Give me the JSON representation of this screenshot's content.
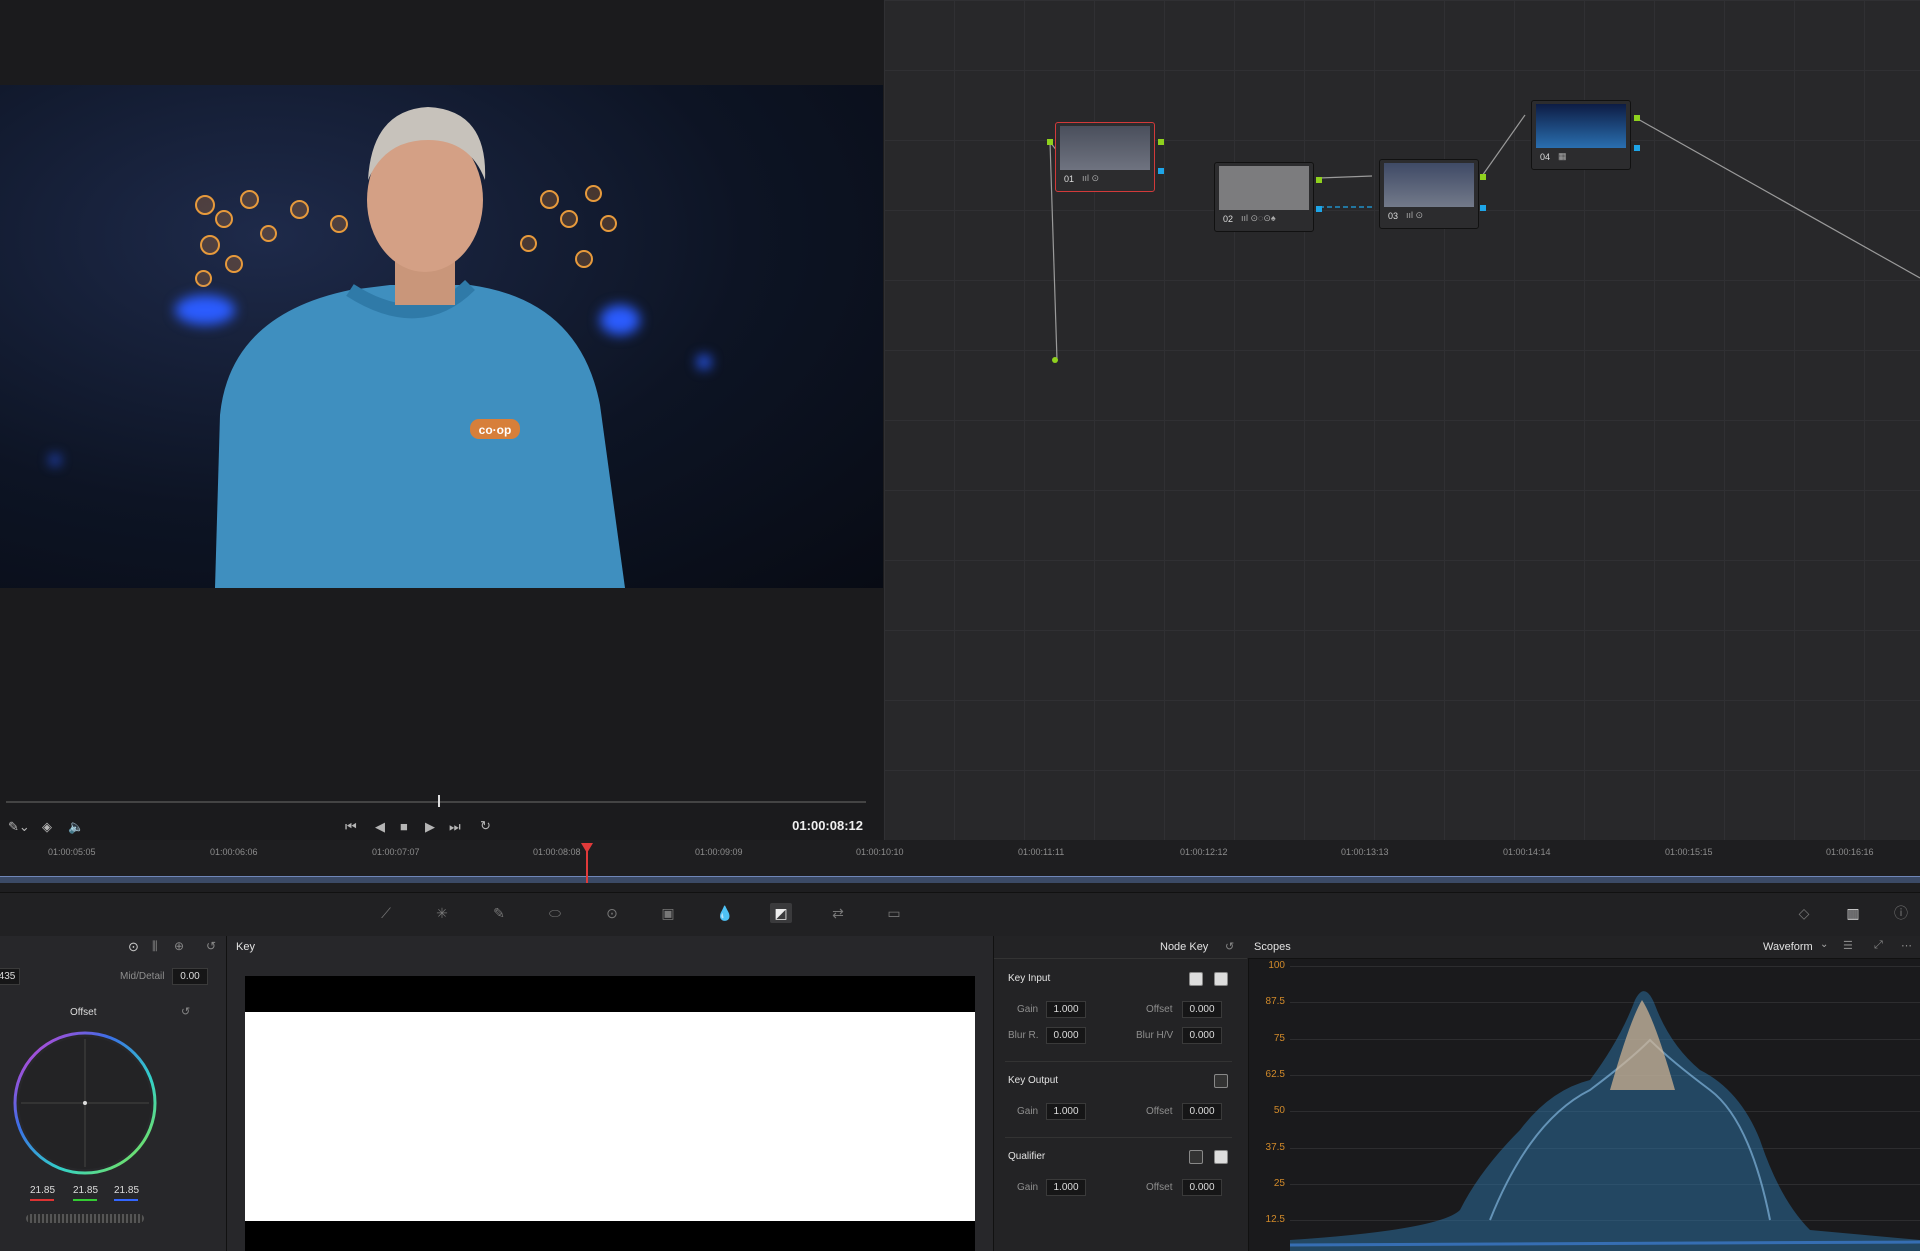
{
  "viewer": {
    "timecode": "01:00:08:12",
    "transport": [
      "skip-start",
      "step-back",
      "stop",
      "play",
      "skip-end",
      "loop"
    ]
  },
  "nodes": [
    {
      "label": "01",
      "selected": true
    },
    {
      "label": "02",
      "selected": false
    },
    {
      "label": "03",
      "selected": false
    },
    {
      "label": "04",
      "selected": false
    }
  ],
  "timeline": {
    "ticks": [
      "01:00:05:05",
      "01:00:06:06",
      "01:00:07:07",
      "01:00:08:08",
      "01:00:09:09",
      "01:00:10:10",
      "01:00:11:11",
      "01:00:12:12",
      "01:00:13:13",
      "01:00:14:14",
      "01:00:15:15",
      "01:00:16:16"
    ]
  },
  "primaries": {
    "partial_value": "435",
    "mid_detail_label": "Mid/Detail",
    "mid_detail_value": "0.00",
    "wheel_label": "Offset",
    "offset_values": [
      "21.85",
      "21.85",
      "21.85"
    ]
  },
  "key_panel": {
    "title": "Key"
  },
  "node_key": {
    "title": "Node Key",
    "key_input": {
      "title": "Key Input",
      "gain_label": "Gain",
      "gain": "1.000",
      "offset_label": "Offset",
      "offset": "0.000",
      "blur_r_label": "Blur R.",
      "blur_r": "0.000",
      "blur_hv_label": "Blur H/V",
      "blur_hv": "0.000"
    },
    "key_output": {
      "title": "Key Output",
      "gain_label": "Gain",
      "gain": "1.000",
      "offset_label": "Offset",
      "offset": "0.000"
    },
    "qualifier": {
      "title": "Qualifier",
      "gain_label": "Gain",
      "gain": "1.000",
      "offset_label": "Offset",
      "offset": "0.000"
    }
  },
  "scopes": {
    "title": "Scopes",
    "mode": "Waveform",
    "y_labels": [
      "100",
      "87.5",
      "75",
      "62.5",
      "50",
      "37.5",
      "25",
      "12.5"
    ]
  },
  "colors": {
    "accent_red": "#e03a3a",
    "scope_label": "#d18a2a",
    "port_green": "#8fd11e",
    "port_blue": "#1ea5e8"
  }
}
